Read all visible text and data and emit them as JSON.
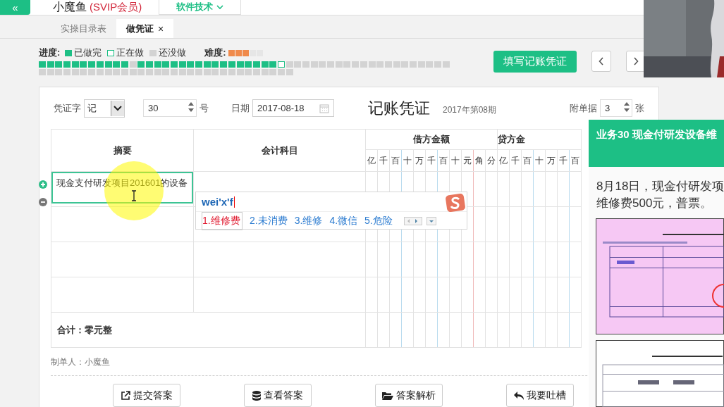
{
  "top_bar": {
    "collapse": "«",
    "user_name": "小魔鱼",
    "membership": "(SVIP会员)",
    "category": "软件技术"
  },
  "tabs": [
    {
      "label": "实操目录表",
      "selected": false
    },
    {
      "label": "做凭证",
      "selected": true,
      "close": "×"
    }
  ],
  "progress": {
    "label": "进度:",
    "legend": [
      {
        "kind": "done",
        "label": "已做完"
      },
      {
        "kind": "current",
        "label": "正在做"
      },
      {
        "kind": "todo",
        "label": "还没做"
      }
    ],
    "difficulty_label": "难度:",
    "stars": 3,
    "cells": [
      {
        "kind": "done"
      },
      {
        "kind": "done"
      },
      {
        "kind": "done"
      },
      {
        "kind": "done"
      },
      {
        "kind": "done"
      },
      {
        "kind": "done"
      },
      {
        "kind": "done"
      },
      {
        "kind": "done"
      },
      {
        "kind": "done"
      },
      {
        "kind": "done"
      },
      {
        "kind": "done"
      },
      {
        "kind": "todo"
      },
      {
        "kind": "done"
      },
      {
        "kind": "done"
      },
      {
        "kind": "done"
      },
      {
        "kind": "done"
      },
      {
        "kind": "done"
      },
      {
        "kind": "done"
      },
      {
        "kind": "done"
      },
      {
        "kind": "done"
      },
      {
        "kind": "done"
      },
      {
        "kind": "done"
      },
      {
        "kind": "done"
      },
      {
        "kind": "done"
      },
      {
        "kind": "done"
      },
      {
        "kind": "done"
      },
      {
        "kind": "done"
      },
      {
        "kind": "done"
      },
      {
        "kind": "done"
      },
      {
        "kind": "current"
      },
      {
        "kind": "todo"
      },
      {
        "kind": "todo"
      },
      {
        "kind": "todo"
      },
      {
        "kind": "todo"
      },
      {
        "kind": "todo"
      },
      {
        "kind": "todo"
      },
      {
        "kind": "todo"
      },
      {
        "kind": "todo"
      },
      {
        "kind": "todo"
      },
      {
        "kind": "todo"
      },
      {
        "kind": "todo"
      },
      {
        "kind": "todo"
      },
      {
        "kind": "todo"
      },
      {
        "kind": "todo"
      },
      {
        "kind": "todo"
      },
      {
        "kind": "todo"
      },
      {
        "kind": "todo"
      },
      {
        "kind": "todo"
      },
      {
        "kind": "todo"
      },
      {
        "kind": "todo"
      },
      {
        "kind": "todo"
      },
      {
        "kind": "todo"
      },
      {
        "kind": "todo"
      },
      {
        "kind": "todo"
      },
      {
        "kind": "todo"
      },
      {
        "kind": "todo"
      },
      {
        "kind": "todo"
      },
      {
        "kind": "todo"
      },
      {
        "kind": "todo"
      },
      {
        "kind": "todo"
      },
      {
        "kind": "todo"
      },
      {
        "kind": "todo"
      },
      {
        "kind": "todo"
      },
      {
        "kind": "todo"
      },
      {
        "kind": "todo"
      },
      {
        "kind": "todo"
      },
      {
        "kind": "todo"
      },
      {
        "kind": "todo"
      },
      {
        "kind": "todo"
      },
      {
        "kind": "todo"
      },
      {
        "kind": "todo"
      },
      {
        "kind": "todo"
      },
      {
        "kind": "todo"
      },
      {
        "kind": "todo"
      },
      {
        "kind": "todo"
      },
      {
        "kind": "todo"
      },
      {
        "kind": "todo"
      },
      {
        "kind": "todo"
      },
      {
        "kind": "todo"
      },
      {
        "kind": "todo"
      },
      {
        "kind": "todo"
      }
    ]
  },
  "fill_button": "填写记账凭证",
  "voucher": {
    "type_label": "凭证字",
    "type_value": "记",
    "number": "30",
    "number_suffix": "号",
    "date_label": "日期",
    "date": "2017-08-18",
    "title": "记账凭证",
    "period": "2017年第08期",
    "attachments_label": "附单据",
    "attachments": "3",
    "attachments_unit": "张",
    "table": {
      "columns": [
        "摘要",
        "会计科目"
      ],
      "debit_heading": "借方金额",
      "credit_heading": "贷方金",
      "debit_digits": [
        "亿",
        "千",
        "百",
        "十",
        "万",
        "千",
        "百",
        "十",
        "元",
        "角",
        "分"
      ],
      "credit_digits": [
        "亿",
        "千",
        "百",
        "十",
        "万",
        "千",
        "百"
      ],
      "rows": [
        {
          "summary": "现金支付研发项目201601的设备",
          "active": true
        },
        {
          "active": false
        },
        {
          "active": false
        },
        {
          "active": false
        }
      ],
      "total": "合计：零元整"
    },
    "preparer": "制单人：小魔鱼"
  },
  "ime": {
    "composition": "wei'x'f",
    "candidates": [
      {
        "label": "1.维修费",
        "selected": true
      },
      {
        "label": "2.未消费",
        "selected": false
      },
      {
        "label": "3.维修",
        "selected": false
      },
      {
        "label": "4.微信",
        "selected": false
      },
      {
        "label": "5.危险",
        "selected": false
      }
    ]
  },
  "actions": [
    {
      "kind": "external-link",
      "label": "提交答案"
    },
    {
      "kind": "database",
      "label": "查看答案"
    },
    {
      "kind": "folder",
      "label": "答案解析"
    },
    {
      "kind": "reply",
      "label": "我要吐槽"
    }
  ],
  "task_panel": {
    "title": "业务30 现金付研发设备维",
    "lines": [
      "8月18日，现金付研发项",
      "维修费500元，普票。"
    ]
  }
}
